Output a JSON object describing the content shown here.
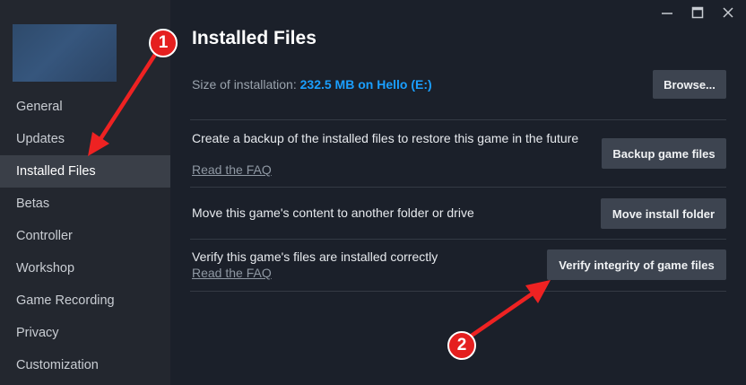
{
  "sidebar": {
    "items": [
      {
        "label": "General",
        "active": false
      },
      {
        "label": "Updates",
        "active": false
      },
      {
        "label": "Installed Files",
        "active": true
      },
      {
        "label": "Betas",
        "active": false
      },
      {
        "label": "Controller",
        "active": false
      },
      {
        "label": "Workshop",
        "active": false
      },
      {
        "label": "Game Recording",
        "active": false
      },
      {
        "label": "Privacy",
        "active": false
      },
      {
        "label": "Customization",
        "active": false
      }
    ]
  },
  "window": {
    "controls": [
      "minimize-icon",
      "maximize-icon",
      "close-icon"
    ]
  },
  "main": {
    "title": "Installed Files",
    "size_label": "Size of installation:",
    "size_value": "232.5 MB on Hello (E:)",
    "browse_button": "Browse...",
    "backup": {
      "text": "Create a backup of the installed files to restore this game in the future",
      "faq": "Read the FAQ",
      "button": "Backup game files"
    },
    "move": {
      "text": "Move this game's content to another folder or drive",
      "button": "Move install folder"
    },
    "verify": {
      "text": "Verify this game's files are installed correctly",
      "faq": "Read the FAQ",
      "button": "Verify integrity of game files"
    }
  },
  "annotations": {
    "callout_1": "1",
    "callout_2": "2"
  },
  "colors": {
    "background": "#1b202a",
    "sidebar": "#23272f",
    "accent": "#1a9fff",
    "button": "#3d4450",
    "annotation": "#e51f1f"
  }
}
